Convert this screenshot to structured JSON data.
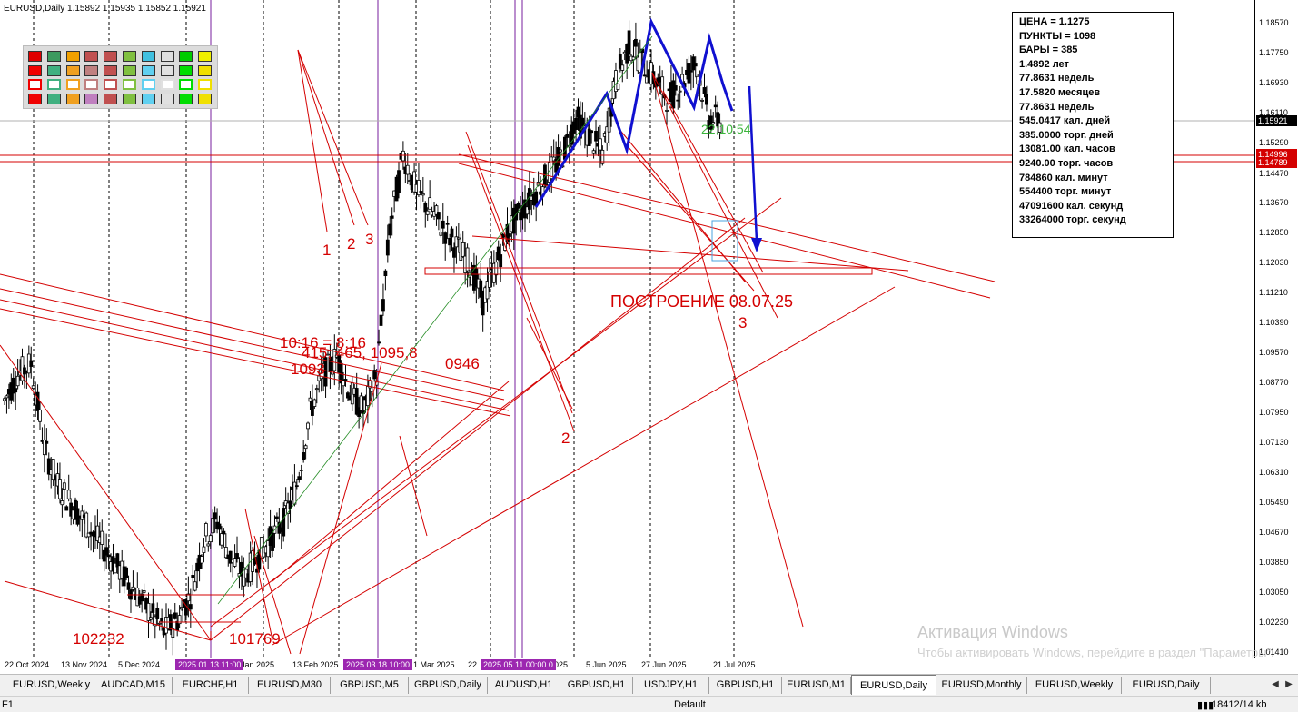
{
  "header": {
    "symbol_info": "EURUSD,Daily  1.15892 1.15935 1.15852 1.15921"
  },
  "colors": {
    "line_red": "#d40000",
    "trend_blue": "#1010d0",
    "bull_candle": "#000000",
    "grid": "#000000",
    "vline": "#6a1b9a",
    "current_price_bg": "#000000",
    "level_bg": "#d40000"
  },
  "price_axis": {
    "labels": [
      "1.18570",
      "1.17750",
      "1.16930",
      "1.16110",
      "1.15290",
      "1.14470",
      "1.13670",
      "1.12850",
      "1.12030",
      "1.11210",
      "1.10390",
      "1.09570",
      "1.08770",
      "1.07950",
      "1.07130",
      "1.06310",
      "1.05490",
      "1.04670",
      "1.03850",
      "1.03050",
      "1.02230",
      "1.01410"
    ],
    "current_price": "1.15921",
    "level_1": "1.14996",
    "level_2": "1.14789"
  },
  "time_axis": {
    "labels": [
      "22 Oct 2024",
      "13 Nov 2024",
      "5 Dec 2024",
      "Jan 2025",
      "13 Feb 2025",
      "1 Mar 2025",
      "22",
      "2025",
      "5 Jun 2025",
      "27 Jun 2025",
      "21 Jul 2025"
    ],
    "vline_labels": [
      "2025.01.13 11:00",
      "2025.03.18 10:00",
      "2025.05.11 00:00 0"
    ]
  },
  "info_panel": {
    "lines": [
      "ЦЕНА = 1.1275",
      "ПУНКТЫ = 1098",
      "БАРЫ = 385",
      "1.4892 лет",
      "77.8631 недель",
      "17.5820 месяцев",
      "77.8631 недель",
      "545.0417 кал. дней",
      "385.0000 торг. дней",
      "13081.00 кал. часов",
      "9240.00 торг. часов",
      "784860 кал. минут",
      "554400 торг. минут",
      "47091600 кал. секунд",
      "33264000 торг. секунд"
    ]
  },
  "annotations": {
    "n1": "1",
    "n2": "2",
    "n3": "3",
    "n2_low": "2",
    "n3_right": "3",
    "construction": "ПОСТРОЕНИЕ 08.07.25",
    "timer": "22:10:54",
    "ratio": "10:16 = 8:16",
    "levels_a": "415, 465, 1095,8",
    "level_0946": "0946",
    "level_1093": "1093",
    "low_left": "102232",
    "low_right": "101769"
  },
  "palette_colors": [
    [
      "#e00000",
      "#3c9a5f",
      "#f0a000",
      "#c05050",
      "#c05050",
      "#80c040",
      "#40c0e0",
      "#e0e0e0",
      "#00cc00",
      "#f0f000"
    ],
    [
      "#f00000",
      "#40b080",
      "#f0a020",
      "#c08080",
      "#c05050",
      "#80c040",
      "#60d0f0",
      "#e0e0e0",
      "#00dd00",
      "#f0e000"
    ],
    [
      "#ffffff",
      "#ffffff",
      "#ffffff",
      "#ffffff",
      "#ffffff",
      "#ffffff",
      "#ffffff",
      "#ffffff",
      "#ffffff",
      "#ffffff"
    ],
    [
      "#f00000",
      "#40b080",
      "#f0a020",
      "#c080c0",
      "#c05050",
      "#80c040",
      "#60d0f0",
      "#e0e0e0",
      "#00dd00",
      "#f0e000"
    ]
  ],
  "watermark": {
    "title": "Активация Windows",
    "subtitle": "Чтобы активировать Windows, перейдите в раздел \"Параметры\"."
  },
  "tabs": [
    "EURUSD,Weekly",
    "AUDCAD,M15",
    "EURCHF,H1",
    "EURUSD,M30",
    "GBPUSD,M5",
    "GBPUSD,Daily",
    "AUDUSD,H1",
    "GBPUSD,H1",
    "USDJPY,H1",
    "GBPUSD,H1",
    "EURUSD,M1",
    "EURUSD,Daily",
    "EURUSD,Monthly",
    "EURUSD,Weekly",
    "EURUSD,Daily"
  ],
  "active_tab_index": 11,
  "status": {
    "left": "F1",
    "profile": "Default",
    "traffic": "18412/14 kb"
  },
  "chart_data": {
    "type": "candlestick",
    "symbol": "EURUSD",
    "timeframe": "Daily",
    "ylim": [
      1.0141,
      1.1857
    ],
    "x": [
      "22 Oct 2024",
      "13 Nov 2024",
      "5 Dec 2024",
      "Jan 2025",
      "13 Feb 2025",
      "1 Mar 2025",
      "5 Jun 2025",
      "27 Jun 2025",
      "21 Jul 2025"
    ],
    "close_path": [
      1.083,
      1.09,
      1.093,
      1.07,
      1.06,
      1.055,
      1.05,
      1.045,
      1.04,
      1.035,
      1.03,
      1.025,
      1.02,
      1.023,
      1.03,
      1.045,
      1.05,
      1.04,
      1.035,
      1.04,
      1.045,
      1.05,
      1.06,
      1.08,
      1.09,
      1.095,
      1.085,
      1.08,
      1.09,
      1.13,
      1.15,
      1.14,
      1.135,
      1.13,
      1.125,
      1.12,
      1.11,
      1.12,
      1.13,
      1.135,
      1.14,
      1.145,
      1.15,
      1.16,
      1.155,
      1.15,
      1.17,
      1.18,
      1.175,
      1.17,
      1.165,
      1.17,
      1.175,
      1.16,
      1.159
    ],
    "last": {
      "open": 1.15892,
      "high": 1.15935,
      "low": 1.15852,
      "close": 1.15921
    }
  }
}
